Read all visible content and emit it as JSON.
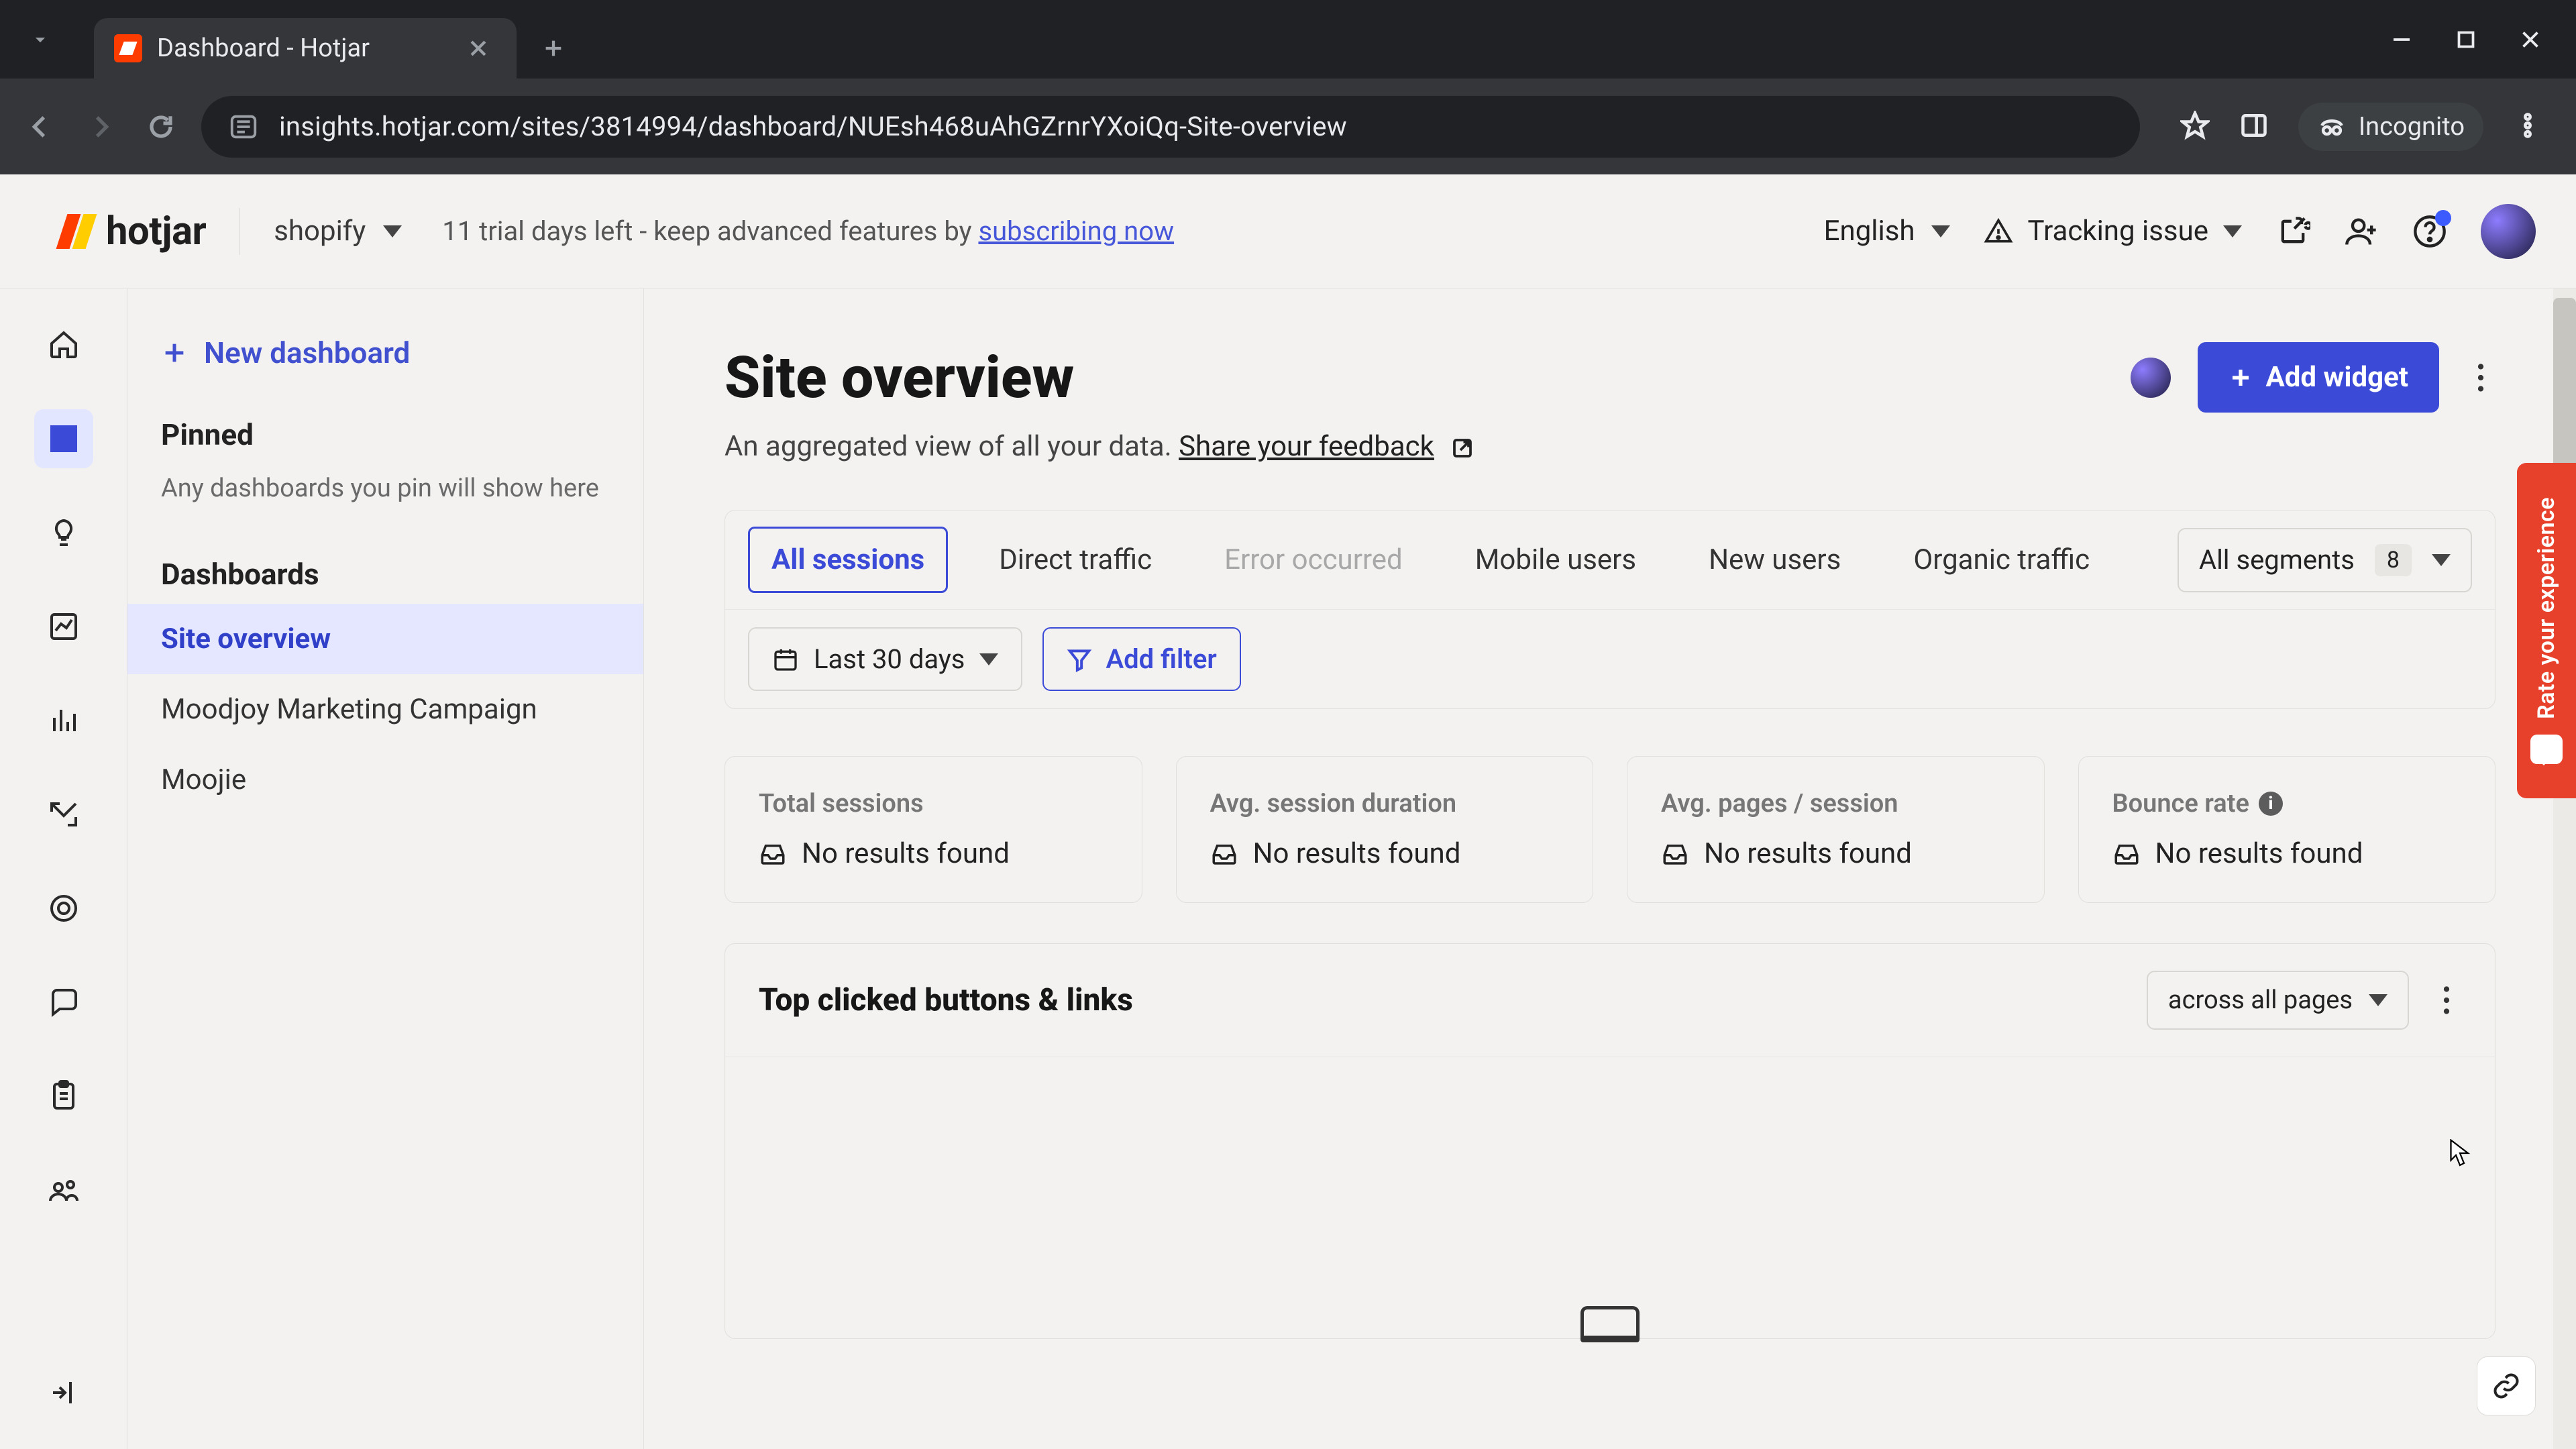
{
  "browser": {
    "tab_title": "Dashboard - Hotjar",
    "url": "insights.hotjar.com/sites/3814994/dashboard/NUEsh468uAhGZrnrYXoiQq-Site-overview",
    "incognito_label": "Incognito"
  },
  "header": {
    "logo_text": "hotjar",
    "site_switcher": "shopify",
    "trial_prefix": "11 trial days left - keep advanced features by ",
    "trial_link": "subscribing now",
    "language": "English",
    "tracking_label": "Tracking issue"
  },
  "sidebar": {
    "new_dashboard": "New dashboard",
    "pinned_title": "Pinned",
    "pinned_hint": "Any dashboards you pin will show here",
    "dashboards_title": "Dashboards",
    "items": [
      {
        "label": "Site overview",
        "active": true
      },
      {
        "label": "Moodjoy Marketing Campaign",
        "active": false
      },
      {
        "label": "Moojie",
        "active": false
      }
    ]
  },
  "page": {
    "title": "Site overview",
    "subtitle_prefix": "An aggregated view of all your data. ",
    "feedback_link": "Share your feedback",
    "add_widget": "Add widget"
  },
  "segments": {
    "tabs": [
      {
        "label": "All sessions",
        "state": "active"
      },
      {
        "label": "Direct traffic",
        "state": "normal"
      },
      {
        "label": "Error occurred",
        "state": "disabled"
      },
      {
        "label": "Mobile users",
        "state": "normal"
      },
      {
        "label": "New users",
        "state": "normal"
      },
      {
        "label": "Organic traffic",
        "state": "normal"
      }
    ],
    "all_label": "All segments",
    "all_count": "8",
    "date_range": "Last 30 days",
    "add_filter": "Add filter"
  },
  "metrics": [
    {
      "label": "Total sessions",
      "value": "No results found",
      "info": false
    },
    {
      "label": "Avg. session duration",
      "value": "No results found",
      "info": false
    },
    {
      "label": "Avg. pages / session",
      "value": "No results found",
      "info": false
    },
    {
      "label": "Bounce rate",
      "value": "No results found",
      "info": true
    }
  ],
  "widget": {
    "title": "Top clicked buttons & links",
    "scope": "across all pages"
  },
  "feedback_tab": "Rate your experience"
}
